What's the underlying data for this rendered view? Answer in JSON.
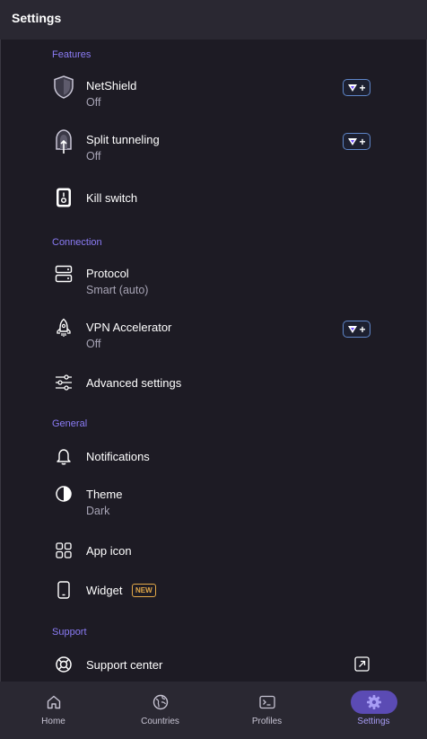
{
  "header": {
    "title": "Settings"
  },
  "sections": {
    "features": {
      "title": "Features"
    },
    "connection": {
      "title": "Connection"
    },
    "general": {
      "title": "General"
    },
    "support": {
      "title": "Support"
    }
  },
  "items": {
    "netshield": {
      "label": "NetShield",
      "value": "Off",
      "icon": "shield-icon"
    },
    "split_tunneling": {
      "label": "Split tunneling",
      "value": "Off",
      "icon": "split-tunnel-icon"
    },
    "kill_switch": {
      "label": "Kill switch",
      "icon": "kill-switch-icon"
    },
    "protocol": {
      "label": "Protocol",
      "value": "Smart (auto)",
      "icon": "server-icon"
    },
    "vpn_accelerator": {
      "label": "VPN Accelerator",
      "value": "Off",
      "icon": "rocket-icon"
    },
    "advanced_settings": {
      "label": "Advanced settings",
      "icon": "sliders-icon"
    },
    "notifications": {
      "label": "Notifications",
      "icon": "bell-icon"
    },
    "theme": {
      "label": "Theme",
      "value": "Dark",
      "icon": "contrast-icon"
    },
    "app_icon": {
      "label": "App icon",
      "icon": "grid-icon"
    },
    "widget": {
      "label": "Widget",
      "badge": "NEW",
      "icon": "phone-icon"
    },
    "support_center": {
      "label": "Support center",
      "icon": "lifebuoy-icon",
      "trailing_icon": "external-link-icon"
    }
  },
  "upgrade_badge": {
    "text": "+",
    "icon": "vpn-plus-logo-icon"
  },
  "bottom_nav": {
    "home": {
      "label": "Home",
      "icon": "home-icon"
    },
    "countries": {
      "label": "Countries",
      "icon": "globe-icon"
    },
    "profiles": {
      "label": "Profiles",
      "icon": "terminal-icon"
    },
    "settings": {
      "label": "Settings",
      "icon": "gear-icon",
      "active": true
    }
  },
  "colors": {
    "background": "#1d1b24",
    "bars": "#2a2832",
    "accent": "#8b7cf6",
    "active_pill": "#5b4bb4",
    "new_badge": "#e3a948",
    "plus_badge_border": "#5f86c9"
  }
}
